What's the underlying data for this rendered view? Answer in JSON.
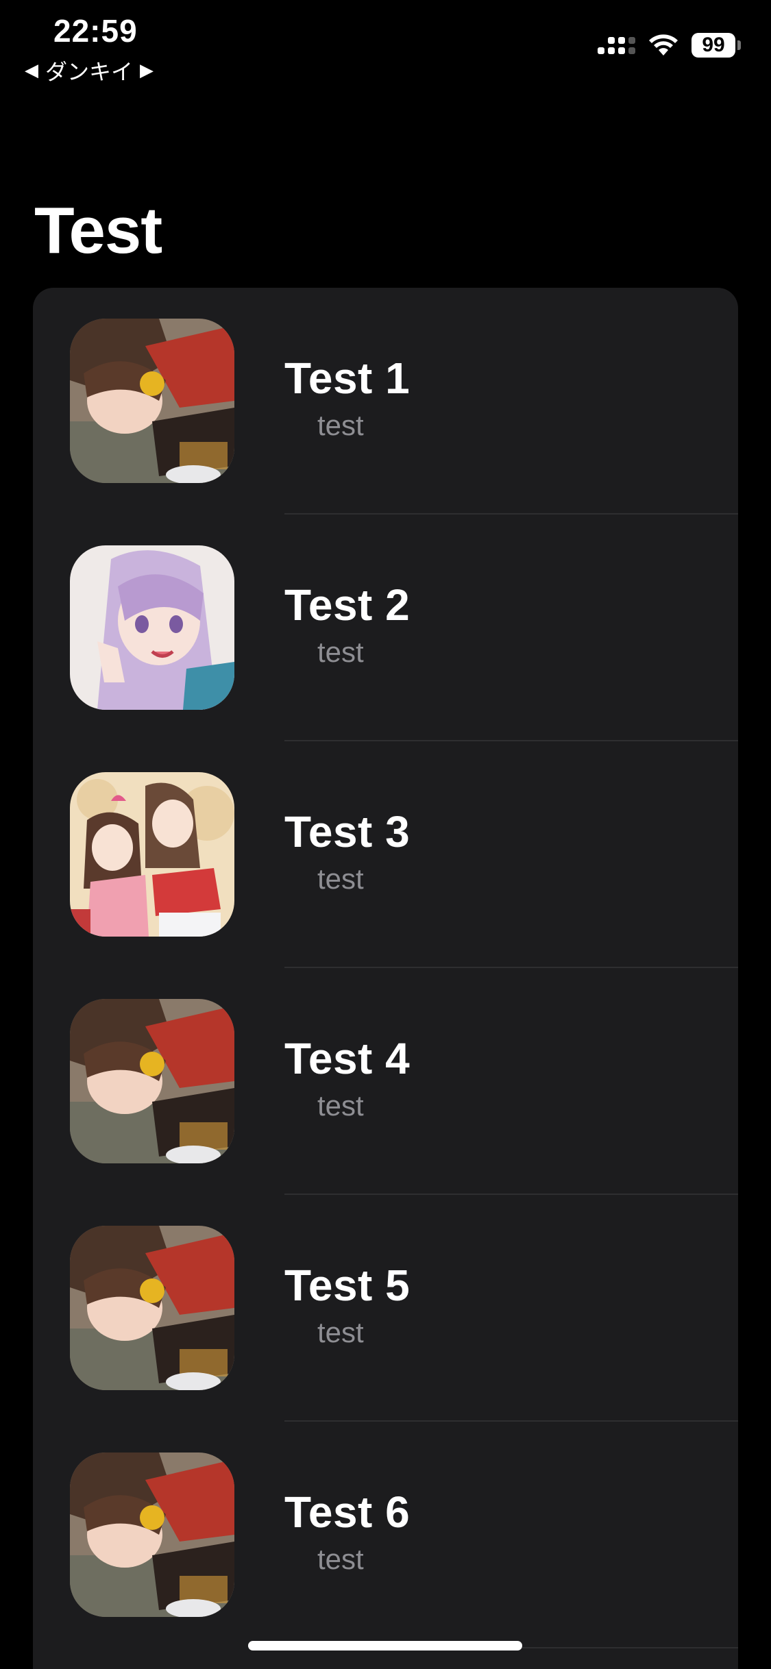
{
  "status_bar": {
    "time": "22:59",
    "back_app": "ダンキイ",
    "battery": "99"
  },
  "title": "Test",
  "items": [
    {
      "title": "Test 1",
      "subtitle": "test",
      "image": "anime-girl-witch-hat-icon"
    },
    {
      "title": "Test 2",
      "subtitle": "test",
      "image": "anime-girl-purple-hair-icon"
    },
    {
      "title": "Test 3",
      "subtitle": "test",
      "image": "anime-two-girls-icon"
    },
    {
      "title": "Test 4",
      "subtitle": "test",
      "image": "anime-girl-witch-hat-icon"
    },
    {
      "title": "Test 5",
      "subtitle": "test",
      "image": "anime-girl-witch-hat-icon"
    },
    {
      "title": "Test 6",
      "subtitle": "test",
      "image": "anime-girl-witch-hat-icon"
    }
  ],
  "colors": {
    "background": "#000000",
    "card": "#1c1c1e",
    "subtitle": "#8e8e93",
    "separator": "#2e2e30"
  }
}
